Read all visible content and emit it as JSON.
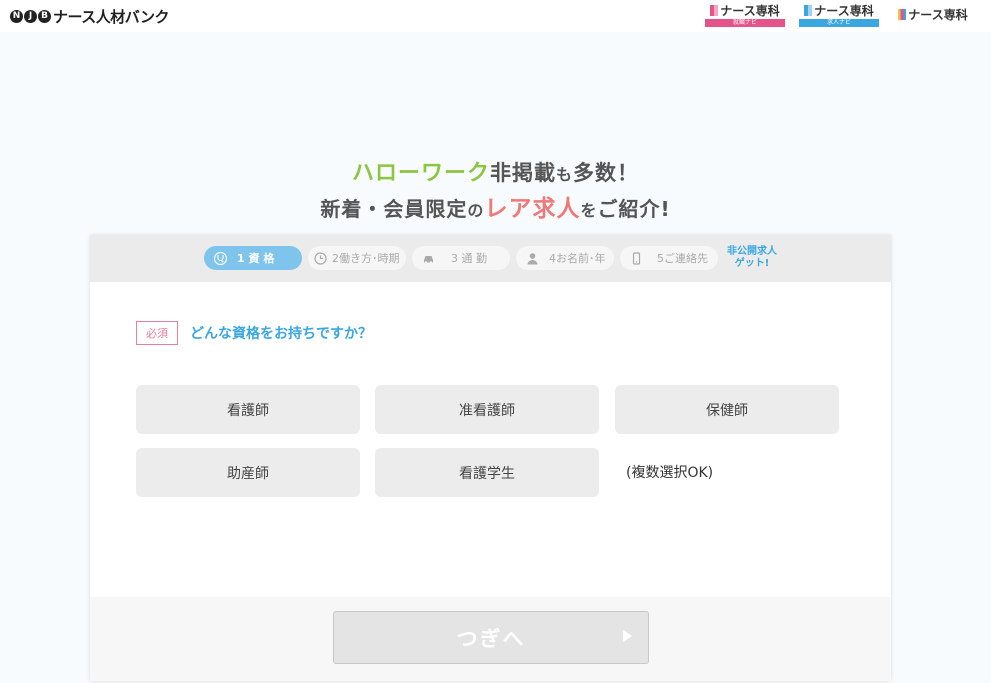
{
  "header": {
    "logo_mark": [
      "N",
      "J",
      "B"
    ],
    "logo_text": "ナース人材バンク",
    "partners": [
      {
        "name": "ナース専科",
        "sub": "就職ナビ",
        "color": "#e4538a"
      },
      {
        "name": "ナース専科",
        "sub": "求人ナビ",
        "color": "#3aa7e0"
      },
      {
        "name": "ナース専科",
        "sub": "",
        "color": "#e8c840"
      }
    ]
  },
  "headline": {
    "line1_green": "ハローワーク",
    "line1_mid": "非掲載",
    "line1_small": "も",
    "line1_end": "多数！",
    "line2_start": "新着・会員限定",
    "line2_small1": "の",
    "line2_pink": "レア求人",
    "line2_small2": "を",
    "line2_end": "ご紹介!"
  },
  "steps": {
    "items": [
      {
        "label": "1 資 格",
        "icon": "stethoscope-icon"
      },
      {
        "label": "2働き方･時期",
        "icon": "clock-icon"
      },
      {
        "label": "3 通 勤",
        "icon": "car-icon"
      },
      {
        "label": "4お名前･年",
        "icon": "person-icon"
      },
      {
        "label": "5ご連絡先",
        "icon": "phone-icon"
      }
    ],
    "cta_line1": "非公開求人",
    "cta_line2": "ゲット!"
  },
  "question": {
    "required_label": "必須",
    "text": "どんな資格をお持ちですか？"
  },
  "options": [
    "看護師",
    "准看護師",
    "保健師",
    "助産師",
    "看護学生"
  ],
  "multi_note": "(複数選択OK)",
  "next_button": "つぎへ"
}
